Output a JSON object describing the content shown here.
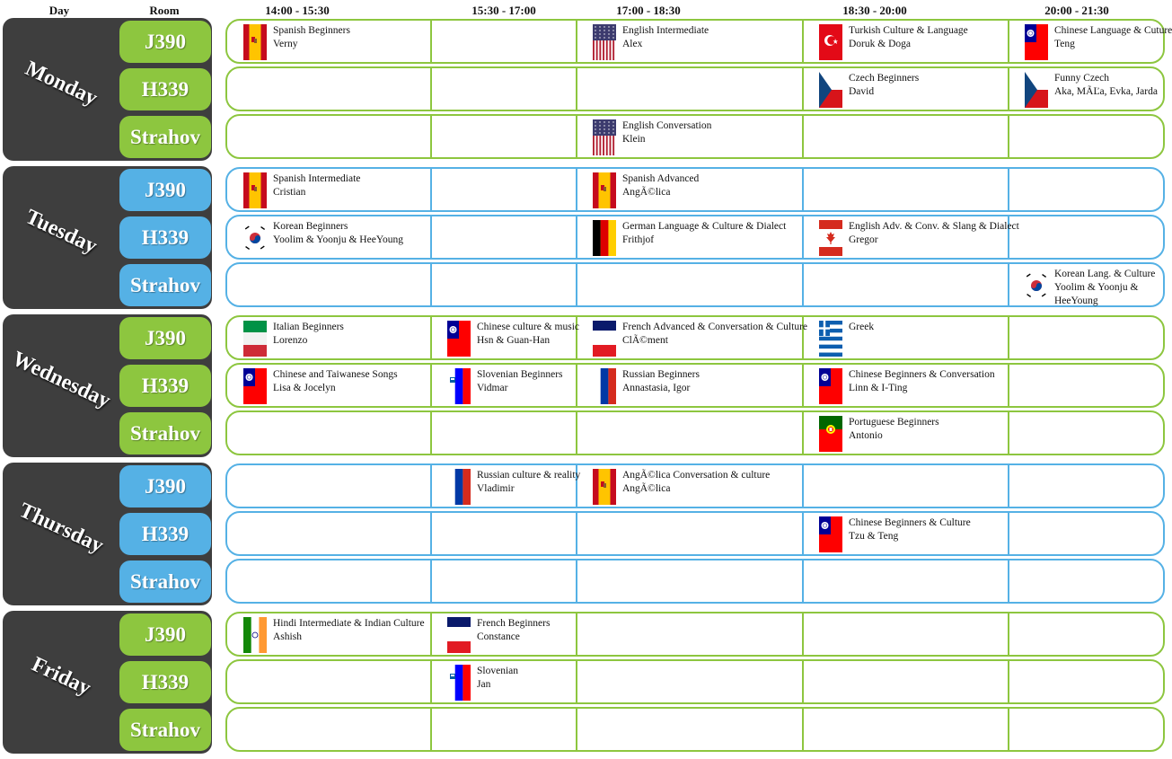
{
  "headers": {
    "day": "Day",
    "room": "Room",
    "slots": [
      "14:00 - 15:30",
      "15:30 - 17:00",
      "17:00 - 18:30",
      "18:30 - 20:00",
      "20:00 - 21:30"
    ]
  },
  "colors": {
    "green": "#8dc63f",
    "blue": "#55b1e5",
    "day_bg": "#3e3e3e"
  },
  "days": [
    {
      "name": "Monday",
      "color": "green",
      "rooms": [
        "J390",
        "H339",
        "Strahov"
      ]
    },
    {
      "name": "Tuesday",
      "color": "blue",
      "rooms": [
        "J390",
        "H339",
        "Strahov"
      ]
    },
    {
      "name": "Wednesday",
      "color": "green",
      "rooms": [
        "J390",
        "H339",
        "Strahov"
      ]
    },
    {
      "name": "Thursday",
      "color": "blue",
      "rooms": [
        "J390",
        "H339",
        "Strahov"
      ]
    },
    {
      "name": "Friday",
      "color": "green",
      "rooms": [
        "J390",
        "H339",
        "Strahov"
      ]
    }
  ],
  "courses": [
    {
      "day": 0,
      "room": 0,
      "slot": 0,
      "flag": "spain-flag-icon",
      "title": "Spanish Beginners",
      "teacher": "Verny"
    },
    {
      "day": 0,
      "room": 0,
      "slot": 2,
      "flag": "usa-flag-icon",
      "title": "English Intermediate",
      "teacher": "Alex"
    },
    {
      "day": 0,
      "room": 0,
      "slot": 3,
      "flag": "turkey-flag-icon",
      "title": "Turkish Culture & Language",
      "teacher": "Doruk & Doga"
    },
    {
      "day": 0,
      "room": 0,
      "slot": 4,
      "flag": "taiwan-flag-icon",
      "title": "Chinese Language & Cuture",
      "teacher": "Teng"
    },
    {
      "day": 0,
      "room": 1,
      "slot": 3,
      "flag": "czech-flag-icon",
      "title": "Czech Beginners",
      "teacher": "David"
    },
    {
      "day": 0,
      "room": 1,
      "slot": 4,
      "flag": "czech-flag-icon",
      "title": "Funny Czech",
      "teacher": "Aka, MÃĽa, Evka, Jarda"
    },
    {
      "day": 0,
      "room": 2,
      "slot": 2,
      "flag": "usa-flag-icon",
      "title": "English Conversation",
      "teacher": "Klein"
    },
    {
      "day": 1,
      "room": 0,
      "slot": 0,
      "flag": "spain-flag-icon",
      "title": "Spanish Intermediate",
      "teacher": "Cristian"
    },
    {
      "day": 1,
      "room": 0,
      "slot": 2,
      "flag": "spain-flag-icon",
      "title": "Spanish Advanced",
      "teacher": "AngÃ©lica"
    },
    {
      "day": 1,
      "room": 1,
      "slot": 0,
      "flag": "korea-flag-icon",
      "title": "Korean Beginners",
      "teacher": "Yoolim & Yoonju & HeeYoung"
    },
    {
      "day": 1,
      "room": 1,
      "slot": 2,
      "flag": "germany-flag-icon",
      "title": "German Language & Culture & Dialect",
      "teacher": "Frithjof"
    },
    {
      "day": 1,
      "room": 1,
      "slot": 3,
      "flag": "canada-flag-icon",
      "title": "English Adv. & Conv. & Slang & Dialect",
      "teacher": "Gregor"
    },
    {
      "day": 1,
      "room": 2,
      "slot": 4,
      "flag": "korea-flag-icon",
      "title": "Korean Lang. & Culture",
      "teacher": "Yoolim & Yoonju & HeeYoung",
      "wrap": true
    },
    {
      "day": 2,
      "room": 0,
      "slot": 0,
      "flag": "italy-flag-icon",
      "title": "Italian Beginners",
      "teacher": "Lorenzo"
    },
    {
      "day": 2,
      "room": 0,
      "slot": 1,
      "flag": "taiwan-flag-icon",
      "title": "Chinese culture & music",
      "teacher": "Hsn & Guan-Han"
    },
    {
      "day": 2,
      "room": 0,
      "slot": 2,
      "flag": "france-flag-icon",
      "title": "French Advanced & Conversation & Culture",
      "teacher": "ClÃ©ment"
    },
    {
      "day": 2,
      "room": 0,
      "slot": 3,
      "flag": "greece-flag-icon",
      "title": "Greek",
      "teacher": ""
    },
    {
      "day": 2,
      "room": 1,
      "slot": 0,
      "flag": "taiwan-flag-icon",
      "title": "Chinese and Taiwanese Songs",
      "teacher": "Lisa & Jocelyn"
    },
    {
      "day": 2,
      "room": 1,
      "slot": 1,
      "flag": "slovenia-flag-icon",
      "title": "Slovenian Beginners",
      "teacher": "Vidmar"
    },
    {
      "day": 2,
      "room": 1,
      "slot": 2,
      "flag": "russia-flag-icon",
      "title": "Russian Beginners",
      "teacher": "Annastasia, Igor"
    },
    {
      "day": 2,
      "room": 1,
      "slot": 3,
      "flag": "taiwan-flag-icon",
      "title": "Chinese Beginners & Conversation",
      "teacher": "Linn & I-Ting"
    },
    {
      "day": 2,
      "room": 2,
      "slot": 3,
      "flag": "portugal-flag-icon",
      "title": "Portuguese Beginners",
      "teacher": "Antonio"
    },
    {
      "day": 3,
      "room": 0,
      "slot": 1,
      "flag": "russia-flag-icon",
      "title": "Russian culture & reality",
      "teacher": "Vladimir"
    },
    {
      "day": 3,
      "room": 0,
      "slot": 2,
      "flag": "spain-flag-icon",
      "title": "AngÃ©lica Conversation & culture",
      "teacher": "AngÃ©lica"
    },
    {
      "day": 3,
      "room": 1,
      "slot": 3,
      "flag": "taiwan-flag-icon",
      "title": "Chinese Beginners & Culture",
      "teacher": "Tzu & Teng"
    },
    {
      "day": 4,
      "room": 0,
      "slot": 0,
      "flag": "india-flag-icon",
      "title": "Hindi Intermediate & Indian Culture",
      "teacher": "Ashish"
    },
    {
      "day": 4,
      "room": 0,
      "slot": 1,
      "flag": "france-flag-icon",
      "title": "French Beginners",
      "teacher": "Constance"
    },
    {
      "day": 4,
      "room": 1,
      "slot": 1,
      "flag": "slovenia-flag-icon",
      "title": "Slovenian",
      "teacher": "Jan"
    }
  ]
}
